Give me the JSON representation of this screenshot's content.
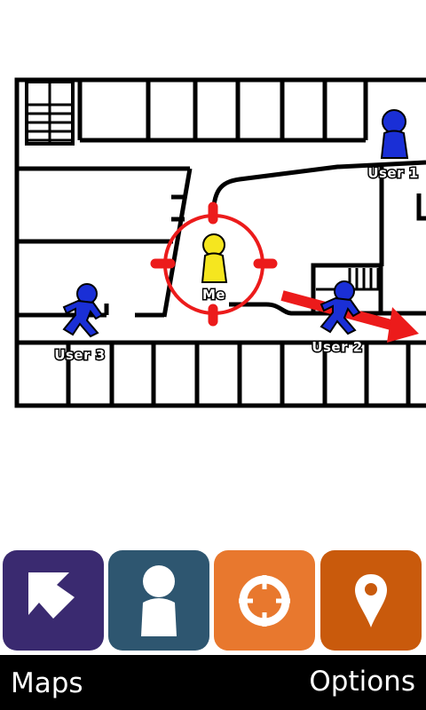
{
  "map": {
    "users": [
      {
        "label": "User 1",
        "color": "#1a2fd6",
        "pose": "standing"
      },
      {
        "label": "User 2",
        "color": "#1a2fd6",
        "pose": "running"
      },
      {
        "label": "User 3",
        "color": "#1a2fd6",
        "pose": "running"
      }
    ],
    "me": {
      "label": "Me",
      "color": "#f5e61f",
      "target_color": "#ec1b1b"
    },
    "arrow_color": "#ec1b1b",
    "wall_color": "#000000"
  },
  "toolbar": {
    "tiles": [
      {
        "icon": "navigate-arrow-icon",
        "color": "#3a2a70"
      },
      {
        "icon": "person-icon",
        "color": "#2e5670"
      },
      {
        "icon": "locate-crosshair-icon",
        "color": "#e8782e"
      },
      {
        "icon": "map-pin-icon",
        "color": "#c95a0c"
      }
    ]
  },
  "softkeys": {
    "left_label": "Maps",
    "right_label": "Options"
  }
}
